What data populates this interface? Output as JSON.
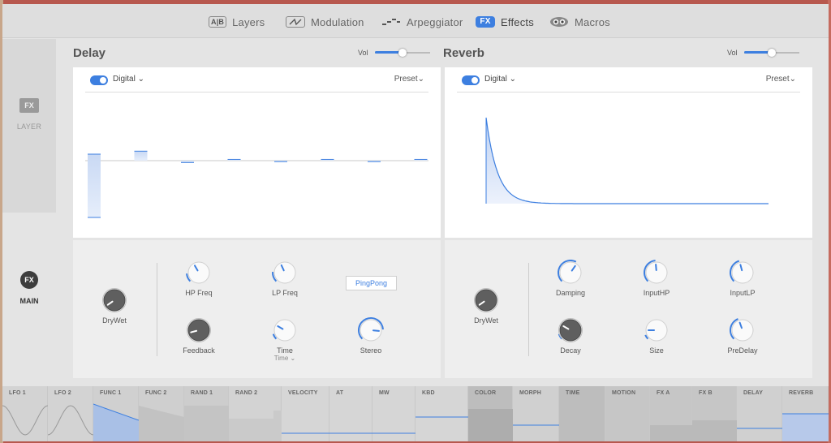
{
  "nav": {
    "tabs": [
      {
        "label": "Layers",
        "icon": "ab-icon",
        "badge": "A|B"
      },
      {
        "label": "Modulation",
        "icon": "modulation-wave-icon"
      },
      {
        "label": "Arpeggiator",
        "icon": "arpeggiator-steps-icon"
      },
      {
        "label": "Effects",
        "icon": "fx-icon",
        "badge": "FX",
        "active": true
      },
      {
        "label": "Macros",
        "icon": "macros-knobs-icon"
      }
    ]
  },
  "sidebar": {
    "layer": {
      "badge": "FX",
      "label": "LAYER"
    },
    "main": {
      "badge": "FX",
      "label": "MAIN"
    }
  },
  "delay": {
    "title": "Delay",
    "vol_label": "Vol",
    "vol_value": 0.5,
    "enabled": true,
    "mode": "Digital",
    "preset": "Preset",
    "knobs": {
      "drywet": "DryWet",
      "hp_freq": "HP Freq",
      "lp_freq": "LP Freq",
      "feedback": "Feedback",
      "time": "Time",
      "time_sub": "Time",
      "stereo": "Stereo"
    },
    "pingpong": "PingPong",
    "taps": [
      -0.9,
      0.15,
      -0.03,
      0.02,
      -0.01,
      0.02,
      -0.01,
      0.02
    ]
  },
  "reverb": {
    "title": "Reverb",
    "vol_label": "Vol",
    "vol_value": 0.5,
    "enabled": true,
    "mode": "Digital",
    "preset": "Preset",
    "knobs": {
      "drywet": "DryWet",
      "damping": "Damping",
      "inputhp": "InputHP",
      "inputlp": "InputLP",
      "decay": "Decay",
      "size": "Size",
      "predelay": "PreDelay"
    }
  },
  "modbar": {
    "cells": [
      "LFO 1",
      "LFO 2",
      "FUNC 1",
      "FUNC 2",
      "RAND 1",
      "RAND 2",
      "VELOCITY",
      "AT",
      "MW",
      "KBD",
      "COLOR",
      "MORPH",
      "TIME",
      "MOTION",
      "FX A",
      "FX B",
      "DELAY",
      "REVERB"
    ]
  },
  "colors": {
    "accent": "#3d7fe0",
    "panel": "#ffffff",
    "control_bg": "#eeeeee",
    "app_bg": "#e4e4e4"
  }
}
